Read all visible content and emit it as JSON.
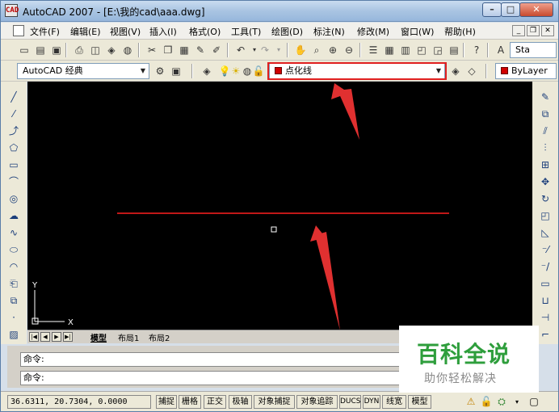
{
  "window": {
    "title": "AutoCAD 2007 - [E:\\我的cad\\aaa.dwg]",
    "app_icon_text": "CAD"
  },
  "menu": [
    "文件(F)",
    "编辑(E)",
    "视图(V)",
    "插入(I)",
    "格式(O)",
    "工具(T)",
    "绘图(D)",
    "标注(N)",
    "修改(M)",
    "窗口(W)",
    "帮助(H)"
  ],
  "toolbar": {
    "workspace": "AutoCAD 经典",
    "linetype": "点化线",
    "linetype_color": "#d00000",
    "style_label": "Sta",
    "color_control": "ByLayer"
  },
  "tabs": [
    "模型",
    "布局1",
    "布局2"
  ],
  "ucs": {
    "y": "Y",
    "x": "X"
  },
  "command": {
    "line1": "命令:",
    "line2": "命令:"
  },
  "status": {
    "coords": "36.6311, 20.7304, 0.0000",
    "buttons": [
      "捕捉",
      "栅格",
      "正交",
      "极轴",
      "对象捕捉",
      "对象追踪",
      "DUCS",
      "DYN",
      "线宽",
      "模型"
    ]
  },
  "watermark": {
    "title": "百科全说",
    "subtitle": "助你轻松解决"
  },
  "colors": {
    "highlight": "#e02020",
    "drawing_line": "#c01818",
    "watermark_green": "#2e9e3c"
  }
}
